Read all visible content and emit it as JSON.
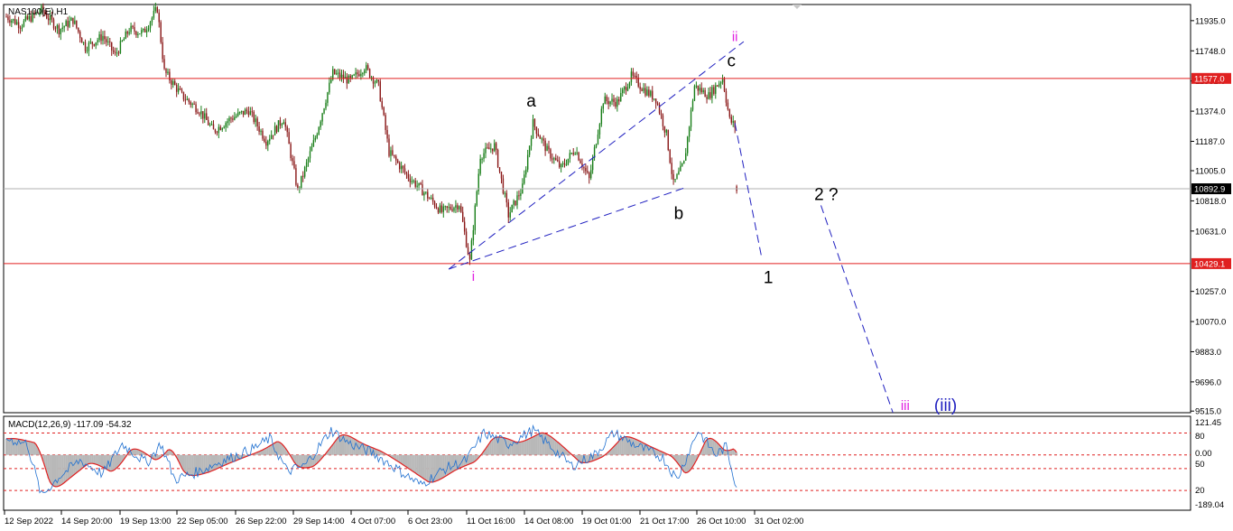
{
  "window": {
    "symbol_label": "NAS100(E),H1"
  },
  "colors": {
    "background": "#ffffff",
    "frame": "#000000",
    "bull_candle": "#1a7f1a",
    "bear_candle": "#8b1a1a",
    "level_line": "#e02020",
    "current_price_line": "#b0b0b0",
    "price_tag_red": "#e02020",
    "price_tag_dark": "#000000",
    "channel_dash": "#2020c0",
    "wave_magenta": "#e020e0",
    "wave_blue": "#2020c0",
    "wave_black": "#000000",
    "macd_histogram": "#b8b8b8",
    "macd_line": "#e02020",
    "macd_signal": "#1e6fd0"
  },
  "chart_data": [
    {
      "type": "candlestick",
      "symbol": "NAS100(E),H1",
      "price_axis": {
        "ticks": [
          11935.0,
          11748.0,
          11561.0,
          11374.0,
          11187.0,
          11005.0,
          10818.0,
          10631.0,
          10257.0,
          10070.0,
          9883.0,
          9696.0,
          9515.0
        ],
        "tick_labels": [
          "11935.0",
          "11748.0",
          "11561.0",
          "11374.0",
          "11187.0",
          "11005.0",
          "10818.0",
          "10631.0",
          "10257.0",
          "10070.0",
          "9883.0",
          "9696.0",
          "9515.0"
        ],
        "ylim": [
          9505,
          12035
        ]
      },
      "time_axis": {
        "tick_labels": [
          "12 Sep 2022",
          "14 Sep 20:00",
          "19 Sep 13:00",
          "22 Sep 05:00",
          "26 Sep 22:00",
          "29 Sep 14:00",
          "4 Oct 07:00",
          "6 Oct 23:00",
          "11 Oct 16:00",
          "14 Oct 08:00",
          "19 Oct 01:00",
          "21 Oct 17:00",
          "26 Oct 10:00",
          "31 Oct 02:00"
        ],
        "bar_range": [
          0,
          420
        ]
      },
      "key_points": [
        {
          "bar": 0,
          "price": 11960
        },
        {
          "bar": 8,
          "price": 11910
        },
        {
          "bar": 20,
          "price": 12000
        },
        {
          "bar": 30,
          "price": 11880
        },
        {
          "bar": 38,
          "price": 11940
        },
        {
          "bar": 45,
          "price": 11770
        },
        {
          "bar": 55,
          "price": 11840
        },
        {
          "bar": 62,
          "price": 11720
        },
        {
          "bar": 70,
          "price": 11880
        },
        {
          "bar": 78,
          "price": 11860
        },
        {
          "bar": 86,
          "price": 12010
        },
        {
          "bar": 90,
          "price": 11620
        },
        {
          "bar": 100,
          "price": 11470
        },
        {
          "bar": 110,
          "price": 11380
        },
        {
          "bar": 118,
          "price": 11250
        },
        {
          "bar": 128,
          "price": 11330
        },
        {
          "bar": 138,
          "price": 11380
        },
        {
          "bar": 148,
          "price": 11190
        },
        {
          "bar": 158,
          "price": 11330
        },
        {
          "bar": 166,
          "price": 10880
        },
        {
          "bar": 176,
          "price": 11210
        },
        {
          "bar": 186,
          "price": 11610
        },
        {
          "bar": 196,
          "price": 11560
        },
        {
          "bar": 204,
          "price": 11650
        },
        {
          "bar": 212,
          "price": 11530
        },
        {
          "bar": 218,
          "price": 11120
        },
        {
          "bar": 228,
          "price": 10980
        },
        {
          "bar": 238,
          "price": 10870
        },
        {
          "bar": 248,
          "price": 10750
        },
        {
          "bar": 258,
          "price": 10800
        },
        {
          "bar": 264,
          "price": 10440
        },
        {
          "bar": 270,
          "price": 11100
        },
        {
          "bar": 278,
          "price": 11160
        },
        {
          "bar": 286,
          "price": 10730
        },
        {
          "bar": 294,
          "price": 10900
        },
        {
          "bar": 300,
          "price": 11300
        },
        {
          "bar": 308,
          "price": 11130
        },
        {
          "bar": 316,
          "price": 11020
        },
        {
          "bar": 324,
          "price": 11140
        },
        {
          "bar": 332,
          "price": 10950
        },
        {
          "bar": 340,
          "price": 11440
        },
        {
          "bar": 348,
          "price": 11430
        },
        {
          "bar": 356,
          "price": 11590
        },
        {
          "bar": 364,
          "price": 11500
        },
        {
          "bar": 370,
          "price": 11450
        },
        {
          "bar": 376,
          "price": 11230
        },
        {
          "bar": 380,
          "price": 10920
        },
        {
          "bar": 386,
          "price": 11050
        },
        {
          "bar": 392,
          "price": 11530
        },
        {
          "bar": 400,
          "price": 11470
        },
        {
          "bar": 408,
          "price": 11580
        },
        {
          "bar": 412,
          "price": 11320
        },
        {
          "bar": 415,
          "price": 11280
        }
      ],
      "last_price_bar": {
        "bar": 416,
        "price": 10892.9
      },
      "horizontal_levels": [
        {
          "price": 11577.0,
          "label": "11577.0",
          "kind": "resistance"
        },
        {
          "price": 10429.1,
          "label": "10429.1",
          "kind": "support"
        }
      ],
      "current_price": {
        "price": 10892.9,
        "label": "10892.9"
      },
      "channel_lines": [
        {
          "from": {
            "bar": 252,
            "price": 10395
          },
          "to": {
            "bar": 420,
            "price": 11805
          }
        },
        {
          "from": {
            "bar": 252,
            "price": 10395
          },
          "to": {
            "bar": 388,
            "price": 10905
          }
        }
      ],
      "projection_lines": [
        {
          "from": {
            "bar": 415,
            "price": 11300
          },
          "to": {
            "bar": 430,
            "price": 10480
          }
        },
        {
          "from": {
            "bar": 464,
            "price": 10790
          },
          "to": {
            "bar": 505,
            "price": 9505
          }
        }
      ],
      "wave_labels": [
        {
          "text": "i",
          "bar": 266,
          "price": 10345,
          "color": "magenta",
          "size": "small"
        },
        {
          "text": "ii",
          "bar": 415,
          "price": 11830,
          "color": "magenta",
          "size": "small"
        },
        {
          "text": "iii",
          "bar": 512,
          "price": 9545,
          "color": "magenta",
          "size": "small"
        },
        {
          "text": "(iii)",
          "bar": 535,
          "price": 9545,
          "color": "blue",
          "size": "large"
        },
        {
          "text": "a",
          "bar": 299,
          "price": 11430,
          "color": "black",
          "size": "large"
        },
        {
          "text": "b",
          "bar": 383,
          "price": 10735,
          "color": "black",
          "size": "large"
        },
        {
          "text": "c",
          "bar": 413,
          "price": 11680,
          "color": "black",
          "size": "large"
        },
        {
          "text": "1",
          "bar": 434,
          "price": 10335,
          "color": "black",
          "size": "large"
        },
        {
          "text": "2 ?",
          "bar": 467,
          "price": 10850,
          "color": "black",
          "size": "large"
        }
      ]
    },
    {
      "type": "macd",
      "title": "MACD(12,26,9) -117.09 -54.32",
      "parameters": [
        12,
        26,
        9
      ],
      "readout": {
        "macd": -117.09,
        "signal": -54.32
      },
      "axis": {
        "ticks": [
          121.45,
          50,
          0.0,
          20,
          -189.04
        ],
        "tick_labels": [
          "121.45",
          "80",
          "0.00",
          "50",
          "20",
          "-189.04"
        ],
        "ylim": [
          -189.04,
          121.45
        ],
        "dashed_levels": [
          80,
          0.0,
          -50,
          -130
        ]
      },
      "key_points": [
        {
          "bar": 0,
          "price": 60
        },
        {
          "bar": 12,
          "price": 40
        },
        {
          "bar": 20,
          "price": -150
        },
        {
          "bar": 30,
          "price": -80
        },
        {
          "bar": 42,
          "price": -20
        },
        {
          "bar": 55,
          "price": -70
        },
        {
          "bar": 66,
          "price": 40
        },
        {
          "bar": 80,
          "price": -30
        },
        {
          "bar": 88,
          "price": 40
        },
        {
          "bar": 96,
          "price": -90
        },
        {
          "bar": 110,
          "price": -60
        },
        {
          "bar": 120,
          "price": -30
        },
        {
          "bar": 140,
          "price": 20
        },
        {
          "bar": 150,
          "price": 60
        },
        {
          "bar": 160,
          "price": -60
        },
        {
          "bar": 170,
          "price": -40
        },
        {
          "bar": 185,
          "price": 90
        },
        {
          "bar": 196,
          "price": 40
        },
        {
          "bar": 208,
          "price": 10
        },
        {
          "bar": 220,
          "price": -40
        },
        {
          "bar": 236,
          "price": -110
        },
        {
          "bar": 250,
          "price": -50
        },
        {
          "bar": 262,
          "price": -20
        },
        {
          "bar": 272,
          "price": 80
        },
        {
          "bar": 286,
          "price": 40
        },
        {
          "bar": 300,
          "price": 90
        },
        {
          "bar": 312,
          "price": 20
        },
        {
          "bar": 322,
          "price": -40
        },
        {
          "bar": 335,
          "price": 0
        },
        {
          "bar": 346,
          "price": 80
        },
        {
          "bar": 360,
          "price": 30
        },
        {
          "bar": 374,
          "price": -10
        },
        {
          "bar": 382,
          "price": -90
        },
        {
          "bar": 394,
          "price": 90
        },
        {
          "bar": 404,
          "price": 0
        },
        {
          "bar": 410,
          "price": 30
        },
        {
          "bar": 416,
          "price": -117
        }
      ]
    }
  ]
}
